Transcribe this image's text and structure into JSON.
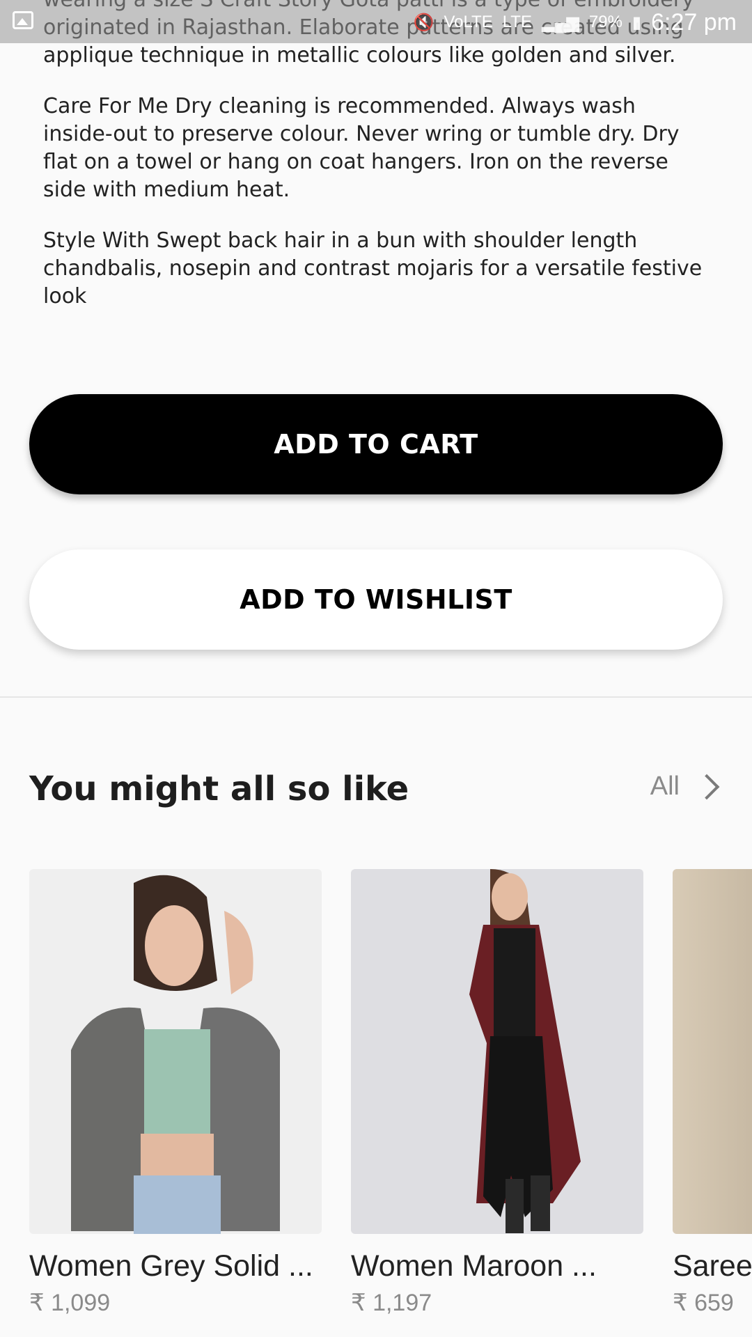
{
  "status_bar": {
    "icons": [
      "image-icon",
      "mute-icon",
      "volte-icon",
      "lte-icon",
      "signal-icon",
      "battery-icon"
    ],
    "volte": "VoLTE",
    "lte": "LTE",
    "battery": "79%",
    "time": "6:27 pm"
  },
  "description": {
    "line_partial": "wearing a size S Craft Story Gota patti is a type of embroidery originated in Rajasthan. Elaborate patterns are created using applique technique in metallic colours like golden and silver.",
    "care": "Care For Me Dry cleaning is recommended. Always wash inside-out to preserve colour. Never wring or tumble dry. Dry flat on a towel or hang on coat hangers. Iron on the reverse side with medium heat.",
    "style": "Style With Swept back hair in a bun with shoulder length chandbalis, nosepin and contrast mojaris for a versatile festive look"
  },
  "actions": {
    "add_to_cart": "ADD TO CART",
    "add_to_wishlist": "ADD TO WISHLIST"
  },
  "recommendations": {
    "title": "You might all so like",
    "all_label": "All",
    "products": [
      {
        "name": "Women Grey Solid ...",
        "price": "₹ 1,099"
      },
      {
        "name": "Women Maroon ...",
        "price": "₹ 1,197"
      },
      {
        "name": "Saree",
        "price": "₹ 659"
      }
    ]
  },
  "colors": {
    "primary_button": "#000000",
    "secondary_button": "#ffffff",
    "price_text": "#8a8a8a"
  }
}
